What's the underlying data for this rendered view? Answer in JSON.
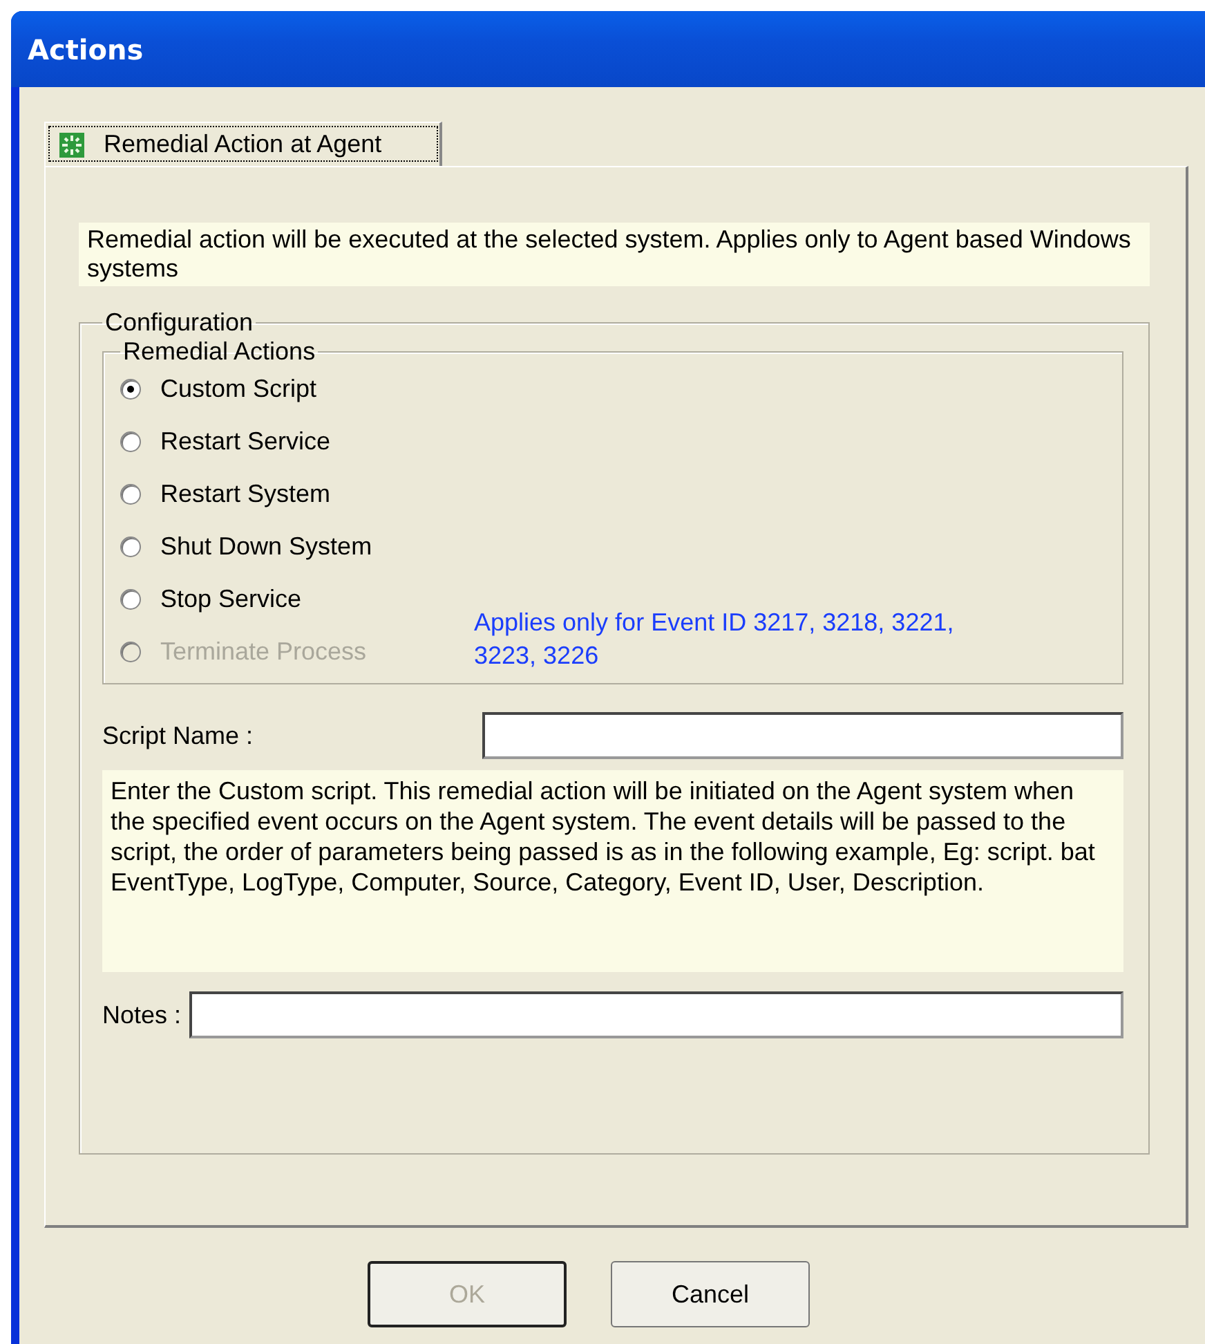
{
  "window": {
    "title": "Actions"
  },
  "tabs": [
    {
      "label": "Remedial Action at Agent",
      "selected": true
    }
  ],
  "info": "Remedial action will be executed at the selected system. Applies only to Agent based Windows systems",
  "configuration": {
    "title": "Configuration",
    "remedial_actions": {
      "title": "Remedial Actions",
      "options": [
        {
          "label": "Custom Script",
          "selected": true,
          "disabled": false
        },
        {
          "label": "Restart Service",
          "selected": false,
          "disabled": false
        },
        {
          "label": "Restart System",
          "selected": false,
          "disabled": false
        },
        {
          "label": "Shut Down System",
          "selected": false,
          "disabled": false
        },
        {
          "label": "Stop Service",
          "selected": false,
          "disabled": false
        },
        {
          "label": "Terminate Process",
          "selected": false,
          "disabled": true
        }
      ],
      "note": "Applies only for Event ID 3217, 3218, 3221, 3223, 3226"
    },
    "script_name": {
      "label": "Script Name :"
    },
    "description": "Enter the Custom script. This remedial action will be initiated on the Agent system when the specified event occurs on the Agent system. The event details will be passed to the script, the order of parameters being passed is as in the following example, Eg: script. bat EventType, LogType, Computer, Source, Category, Event ID, User, Description.",
    "notes": {
      "label": "Notes :"
    }
  },
  "buttons": [
    {
      "label": "OK",
      "disabled": true
    },
    {
      "label": "Cancel",
      "disabled": false
    }
  ]
}
